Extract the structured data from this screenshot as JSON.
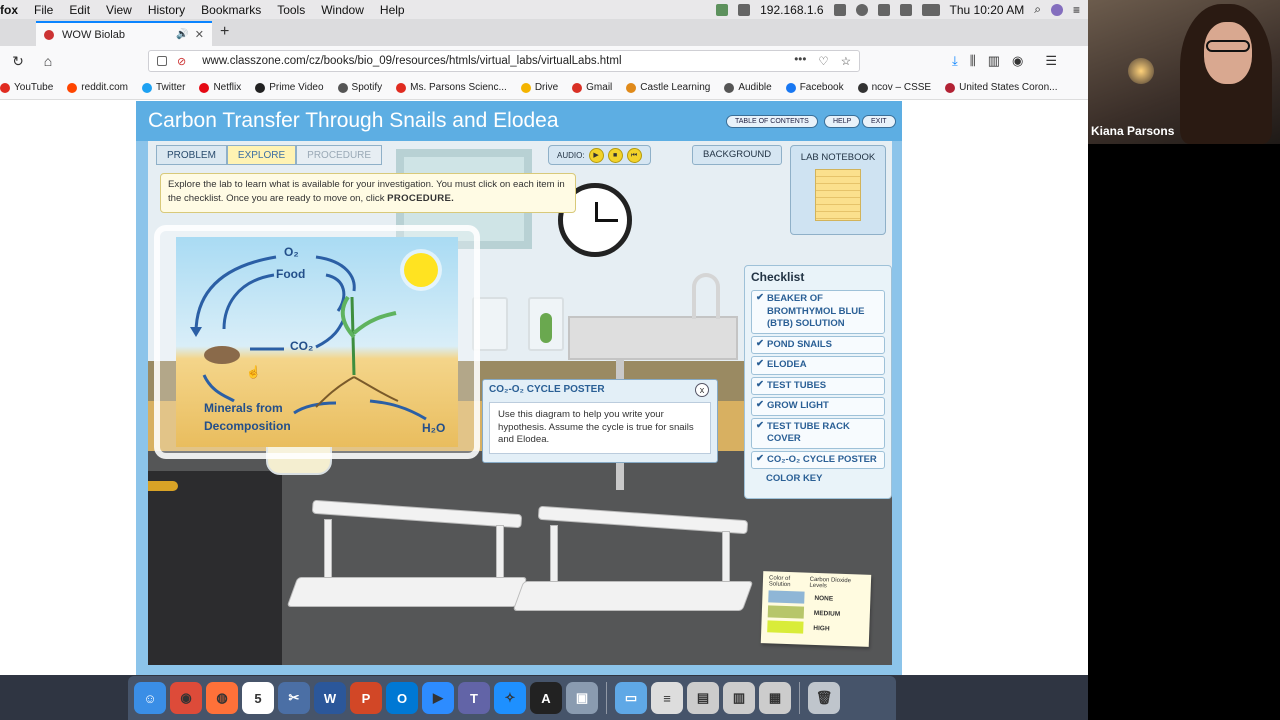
{
  "menubar": {
    "app_name": "fox",
    "items": [
      "File",
      "Edit",
      "View",
      "History",
      "Bookmarks",
      "Tools",
      "Window",
      "Help"
    ],
    "ip": "192.168.1.6",
    "clock": "Thu 10:20 AM"
  },
  "browser": {
    "tab_title": "WOW Biolab",
    "url": "www.classzone.com/cz/books/bio_09/resources/htmls/virtual_labs/virtualLabs.html",
    "new_tab_symbol": "+",
    "bookmarks": [
      {
        "label": "YouTube",
        "color": "#e02b20"
      },
      {
        "label": "reddit.com",
        "color": "#ff4500"
      },
      {
        "label": "Twitter",
        "color": "#1da1f2"
      },
      {
        "label": "Netflix",
        "color": "#e50914"
      },
      {
        "label": "Prime Video",
        "color": "#222222"
      },
      {
        "label": "Spotify",
        "color": "#555555"
      },
      {
        "label": "Ms. Parsons Scienc...",
        "color": "#e02b20"
      },
      {
        "label": "Drive",
        "color": "#f4b400"
      },
      {
        "label": "Gmail",
        "color": "#d93025"
      },
      {
        "label": "Castle Learning",
        "color": "#e08a1a"
      },
      {
        "label": "Audible",
        "color": "#555555"
      },
      {
        "label": "Facebook",
        "color": "#1877f2"
      },
      {
        "label": "ncov – CSSE",
        "color": "#333333"
      },
      {
        "label": "United States Coron...",
        "color": "#b22234"
      }
    ]
  },
  "lab": {
    "title": "Carbon Transfer Through Snails and Elodea",
    "header_buttons": [
      "TABLE OF CONTENTS",
      "HELP",
      "EXIT"
    ],
    "tabs": [
      {
        "label": "PROBLEM",
        "state": "normal"
      },
      {
        "label": "EXPLORE",
        "state": "active"
      },
      {
        "label": "PROCEDURE",
        "state": "disabled"
      }
    ],
    "audio_label": "AUDIO:",
    "audio_buttons": [
      "▶",
      "■",
      "⏮"
    ],
    "background_label": "BACKGROUND",
    "notebook_label": "LAB NOTEBOOK",
    "instructions_text": "Explore the lab to learn what is available for your investigation. You must click on each item in the checklist. Once you are ready to move on, click ",
    "instructions_bold": "PROCEDURE.",
    "poster": {
      "o2": "O₂",
      "food": "Food",
      "co2": "CO₂",
      "minerals_line1": "Minerals from",
      "minerals_line2": "Decomposition",
      "h2o": "H₂O"
    },
    "popup": {
      "title": "CO₂-O₂ CYCLE POSTER",
      "close": "x",
      "body": "Use this diagram to help you write your hypothesis. Assume the cycle is true for snails and Elodea."
    },
    "checklist": {
      "title": "Checklist",
      "items": [
        {
          "label": "BEAKER OF BROMTHYMOL BLUE (BTB) SOLUTION",
          "checked": true
        },
        {
          "label": "POND SNAILS",
          "checked": true
        },
        {
          "label": "ELODEA",
          "checked": true
        },
        {
          "label": "TEST TUBES",
          "checked": true
        },
        {
          "label": "GROW LIGHT",
          "checked": true
        },
        {
          "label": "TEST TUBE RACK COVER",
          "checked": true
        },
        {
          "label": "CO₂-O₂ CYCLE POSTER",
          "checked": true
        },
        {
          "label": "COLOR KEY",
          "checked": false
        }
      ]
    },
    "color_key": {
      "header_left": "Color of Solution",
      "header_right": "Carbon Dioxide Levels",
      "rows": [
        {
          "label": "NONE",
          "color": "#8fb6d6"
        },
        {
          "label": "MEDIUM",
          "color": "#b7c66a"
        },
        {
          "label": "HIGH",
          "color": "#d9ec39"
        }
      ]
    }
  },
  "webcam": {
    "name": "Kiana Parsons"
  },
  "dock": {
    "apps": [
      {
        "name": "finder",
        "color": "#3a8ee6",
        "glyph": "☺"
      },
      {
        "name": "chrome",
        "color": "#dd4b39",
        "glyph": "◉"
      },
      {
        "name": "firefox",
        "color": "#ff7139",
        "glyph": "◍"
      },
      {
        "name": "calendar",
        "color": "#ffffff",
        "glyph": "5"
      },
      {
        "name": "scissors",
        "color": "#4b6fa5",
        "glyph": "✂"
      },
      {
        "name": "word",
        "color": "#2b579a",
        "glyph": "W"
      },
      {
        "name": "powerpoint",
        "color": "#d24726",
        "glyph": "P"
      },
      {
        "name": "outlook",
        "color": "#0078d4",
        "glyph": "O"
      },
      {
        "name": "zoom",
        "color": "#2d8cff",
        "glyph": "▶"
      },
      {
        "name": "teams",
        "color": "#6264a7",
        "glyph": "T"
      },
      {
        "name": "safari",
        "color": "#1e90ff",
        "glyph": "✧"
      },
      {
        "name": "acrobat",
        "color": "#222222",
        "glyph": "A"
      },
      {
        "name": "preview",
        "color": "#8a9bb0",
        "glyph": "▣"
      },
      {
        "name": "folder",
        "color": "#5fa8e6",
        "glyph": "▭"
      },
      {
        "name": "document",
        "color": "#dddddd",
        "glyph": "≡"
      },
      {
        "name": "screenshot",
        "color": "#cccccc",
        "glyph": "▤"
      },
      {
        "name": "screenshot2",
        "color": "#cccccc",
        "glyph": "▥"
      },
      {
        "name": "screenshot3",
        "color": "#cccccc",
        "glyph": "▦"
      },
      {
        "name": "trash",
        "color": "#bfc5cc",
        "glyph": "🗑"
      }
    ]
  }
}
